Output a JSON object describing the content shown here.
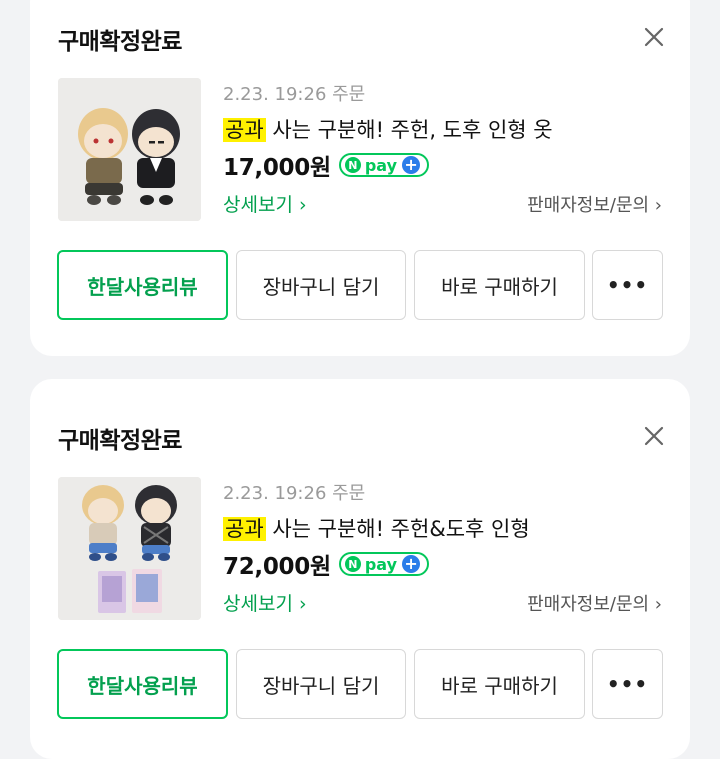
{
  "orders": [
    {
      "status": "구매확정완료",
      "order_date": "2.23. 19:26 주문",
      "title_highlight": "공과",
      "title_rest": " 사는 구분해! 주헌, 도후 인형 옷",
      "price": "17,000원",
      "npay": {
        "n": "N",
        "text": "pay",
        "plus": "+"
      },
      "detail_link": "상세보기 ›",
      "seller_link": "판매자정보/문의 ›",
      "buttons": {
        "review": "한달사용리뷰",
        "cart": "장바구니 담기",
        "buy": "바로 구매하기",
        "more": "•••"
      }
    },
    {
      "status": "구매확정완료",
      "order_date": "2.23. 19:26 주문",
      "title_highlight": "공과",
      "title_rest": " 사는 구분해! 주헌&도후 인형",
      "price": "72,000원",
      "npay": {
        "n": "N",
        "text": "pay",
        "plus": "+"
      },
      "detail_link": "상세보기 ›",
      "seller_link": "판매자정보/문의 ›",
      "buttons": {
        "review": "한달사용리뷰",
        "cart": "장바구니 담기",
        "buy": "바로 구매하기",
        "more": "•••"
      }
    }
  ],
  "colors": {
    "accent": "#03c75a",
    "highlight": "#fff100",
    "npay_plus": "#2b7de9",
    "background": "#f2f3f5"
  },
  "icons": {
    "close": "close-icon"
  }
}
